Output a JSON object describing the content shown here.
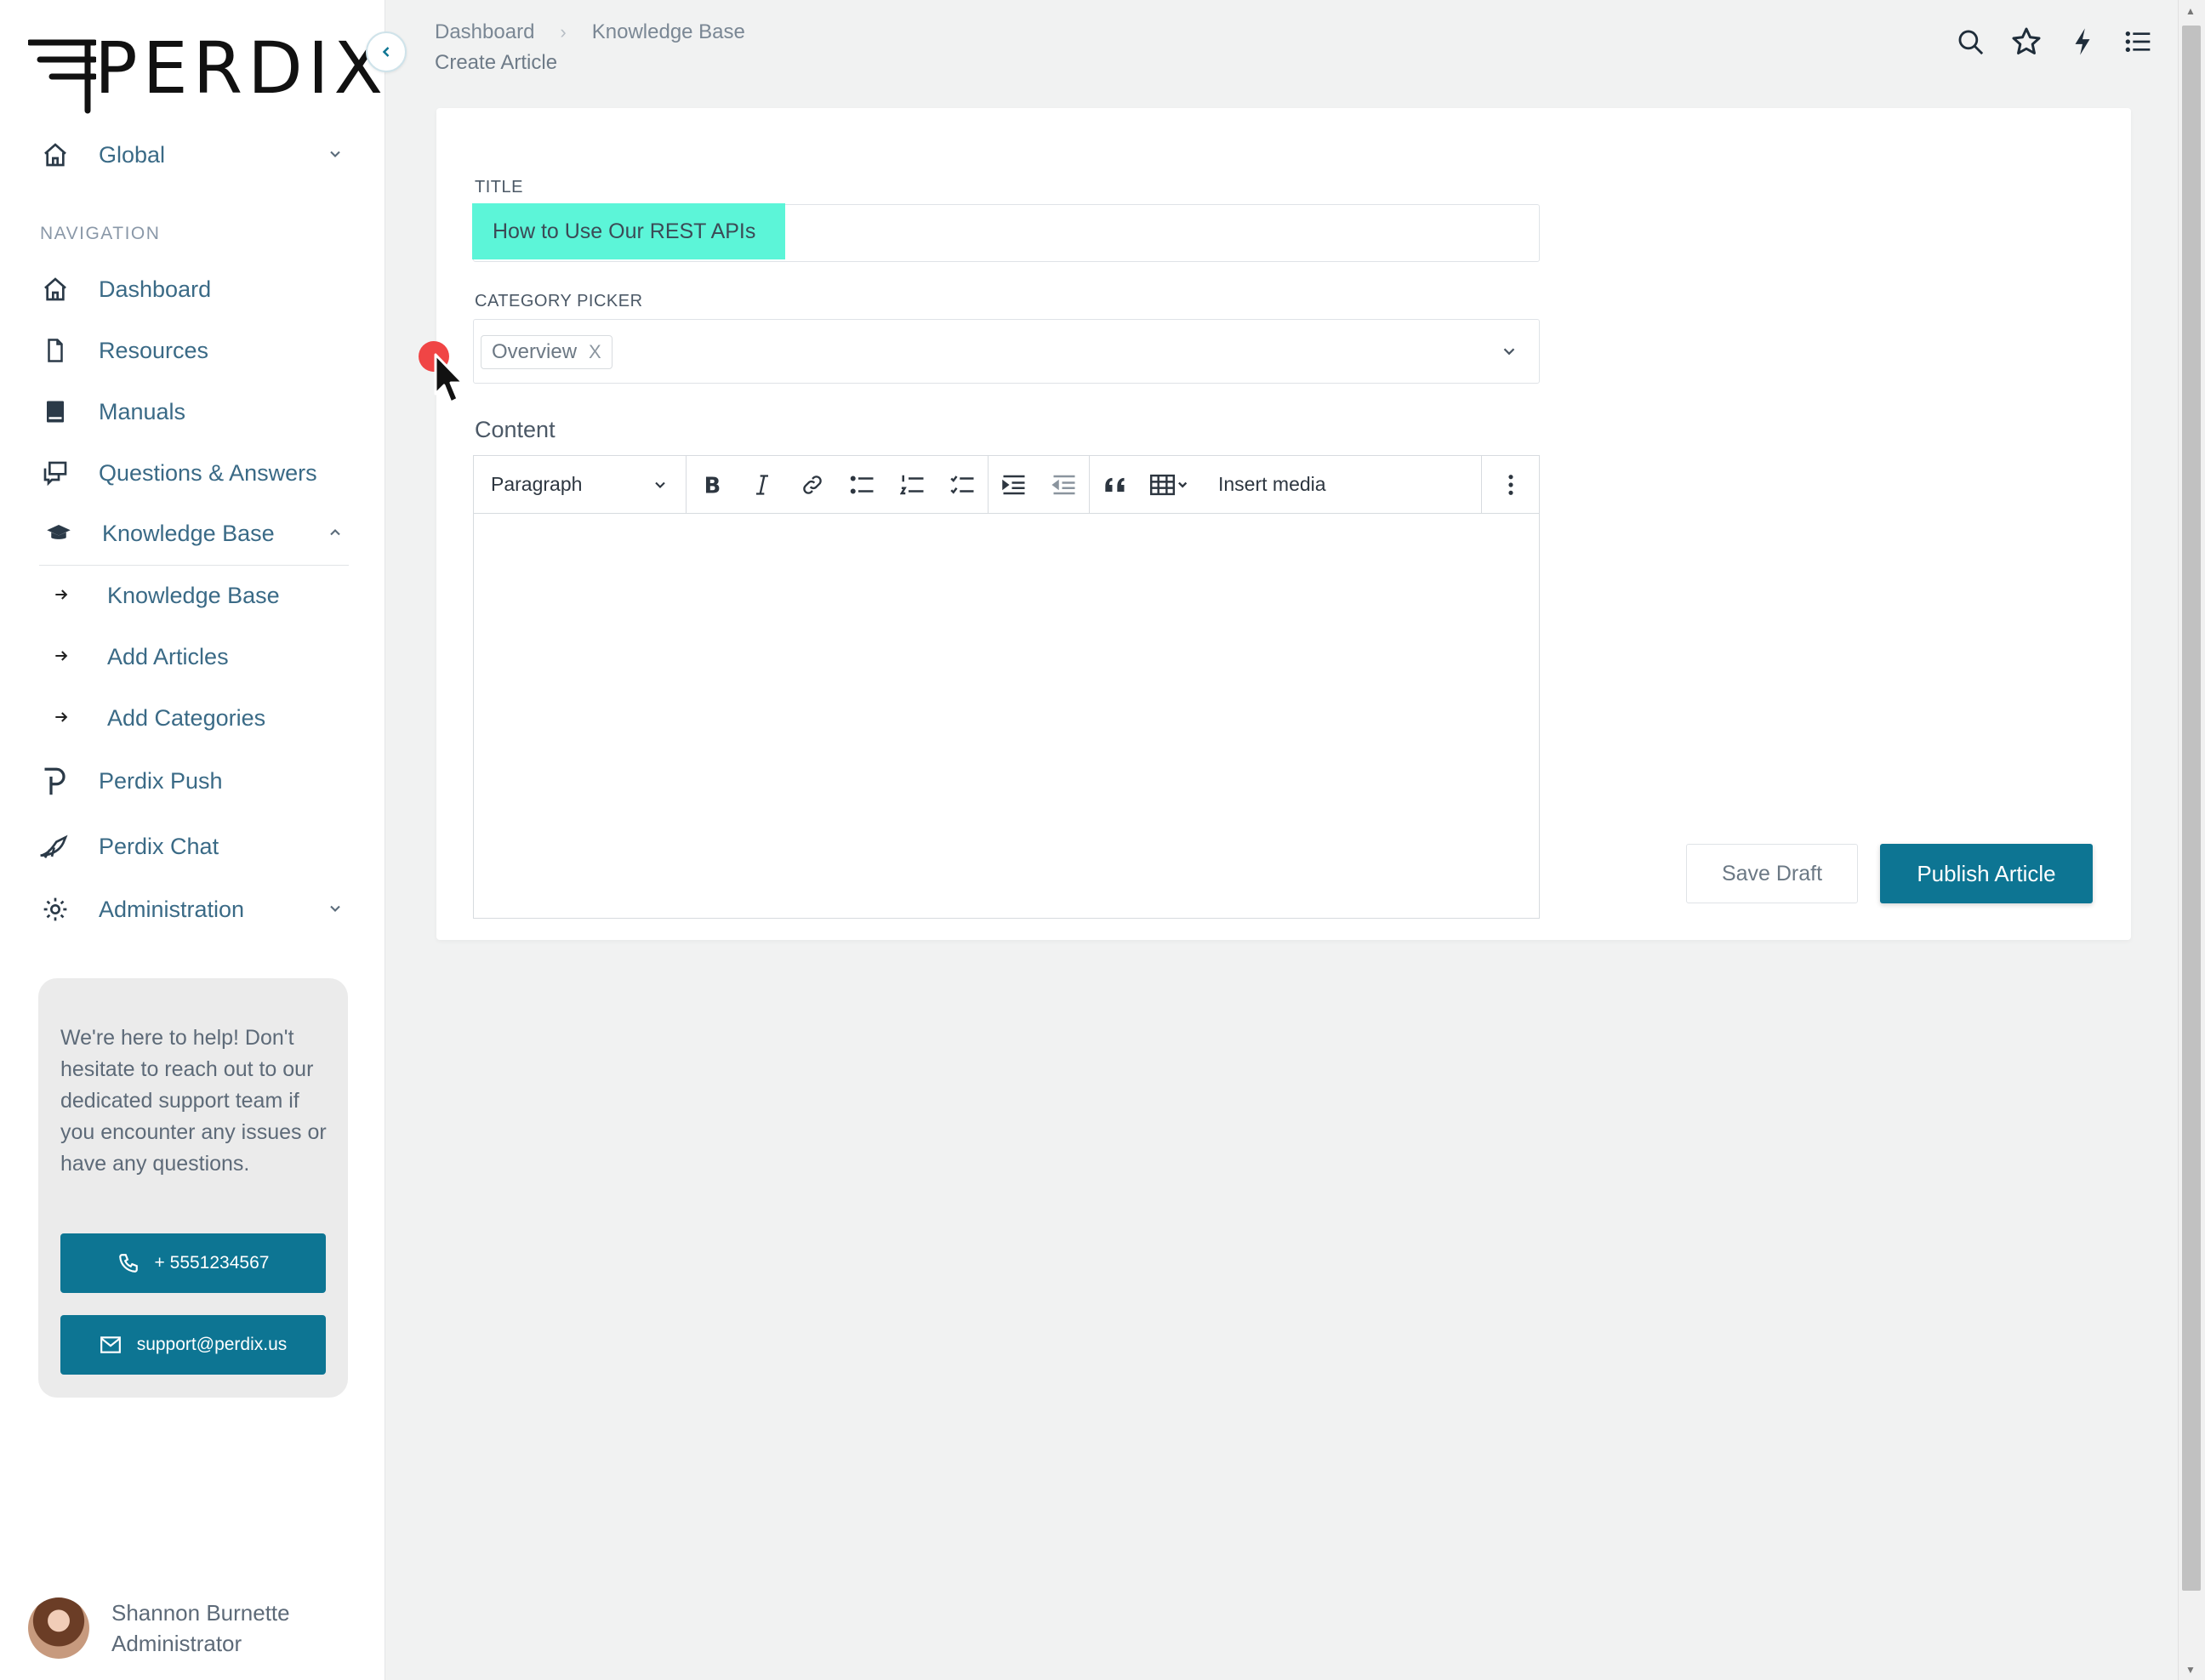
{
  "sidebar": {
    "logo_text": "PERDIX",
    "global": {
      "label": "Global"
    },
    "nav_heading": "NAVIGATION",
    "items": [
      {
        "label": "Dashboard",
        "icon": "home-icon"
      },
      {
        "label": "Resources",
        "icon": "file-icon"
      },
      {
        "label": "Manuals",
        "icon": "book-icon"
      },
      {
        "label": "Questions & Answers",
        "icon": "chat-bubbles-icon"
      },
      {
        "label": "Knowledge Base",
        "icon": "graduation-cap-icon",
        "expanded": true
      },
      {
        "label": "Perdix Push",
        "icon": "perdix-push-icon"
      },
      {
        "label": "Perdix Chat",
        "icon": "bird-icon"
      },
      {
        "label": "Administration",
        "icon": "gear-icon"
      }
    ],
    "kb_sub_items": [
      {
        "label": "Knowledge Base"
      },
      {
        "label": "Add Articles"
      },
      {
        "label": "Add Categories"
      }
    ],
    "help": {
      "text": "We're here to help! Don't hesitate to reach out to our dedicated support team if you encounter any issues or have any questions.",
      "phone": "+ 5551234567",
      "email": "support@perdix.us"
    },
    "user": {
      "name": "Shannon Burnette",
      "role": "Administrator"
    }
  },
  "header": {
    "breadcrumb": [
      "Dashboard",
      "Knowledge Base"
    ],
    "title": "Create Article",
    "icons": [
      "search-icon",
      "star-icon",
      "lightning-icon",
      "list-icon"
    ]
  },
  "form": {
    "title_label": "TITLE",
    "title_value": "How to Use Our REST APIs",
    "category_label": "CATEGORY PICKER",
    "category_chip": "Overview",
    "category_chip_remove": "X",
    "content_label": "Content",
    "toolbar": {
      "paragraph": "Paragraph",
      "insert_media": "Insert media"
    },
    "save_draft": "Save Draft",
    "publish": "Publish Article"
  },
  "colors": {
    "accent": "#0d7593",
    "nav_text": "#3a6a86",
    "highlight": "#5cf5d8"
  }
}
